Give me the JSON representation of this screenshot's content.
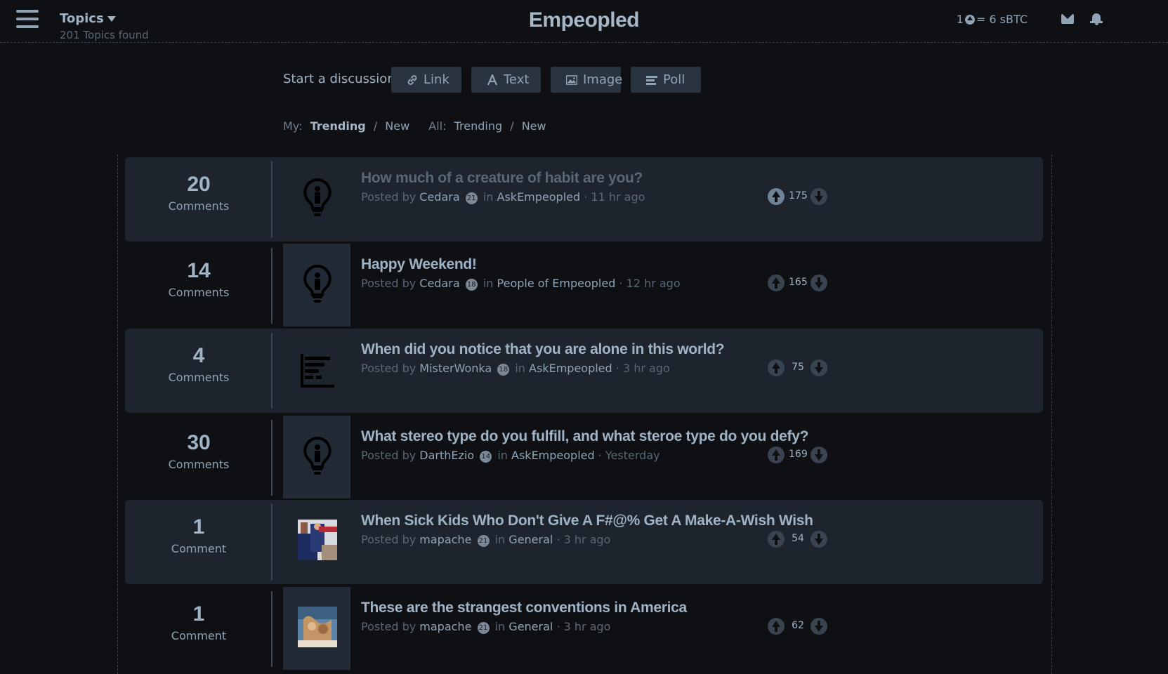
{
  "header": {
    "topics_label": "Topics",
    "topics_found": "201 Topics found",
    "brand": "Empeopled",
    "rate_prefix": "1",
    "rate_suffix": "= 6 sBTC"
  },
  "discussion": {
    "label": "Start a discussion:",
    "buttons": [
      {
        "label": "Link",
        "icon": "link-icon"
      },
      {
        "label": "Text",
        "icon": "text-icon"
      },
      {
        "label": "Image",
        "icon": "image-icon"
      },
      {
        "label": "Poll",
        "icon": "poll-icon"
      }
    ]
  },
  "filters": {
    "my_label": "My:",
    "my_trending": "Trending",
    "sep1": "/",
    "my_new": "New",
    "all_label": "All:",
    "all_trending": "Trending",
    "sep2": "/",
    "all_new": "New"
  },
  "posts": [
    {
      "count": "20",
      "count_label": "Comments",
      "thumb": "lightbulb-icon",
      "title": "How much of a creature of habit are you?",
      "posted_by": "Posted by",
      "author": "Cedara",
      "level": "21",
      "in": "in",
      "community": "AskEmpeopled",
      "time": "· 11 hr ago",
      "score": "175"
    },
    {
      "count": "14",
      "count_label": "Comments",
      "thumb": "lightbulb-icon",
      "title": "Happy Weekend!",
      "posted_by": "Posted by",
      "author": "Cedara",
      "level": "18",
      "in": "in",
      "community": "People of Empeopled",
      "time": "· 12 hr ago",
      "score": "165"
    },
    {
      "count": "4",
      "count_label": "Comments",
      "thumb": "poll-chart-icon",
      "title": "When did you notice that you are alone in this world?",
      "posted_by": "Posted by",
      "author": "MisterWonka",
      "level": "18",
      "in": "in",
      "community": "AskEmpeopled",
      "time": "· 3 hr ago",
      "score": "75"
    },
    {
      "count": "30",
      "count_label": "Comments",
      "thumb": "lightbulb-icon",
      "title": "What stereo type do you fulfill, and what steroe type do you defy?",
      "posted_by": "Posted by",
      "author": "DarthEzio",
      "level": "14",
      "in": "in",
      "community": "AskEmpeopled",
      "time": "· Yesterday",
      "score": "169"
    },
    {
      "count": "1",
      "count_label": "Comment",
      "thumb": "photo-thumbnail",
      "title": "When Sick Kids Who Don't Give A F#@% Get A Make-A-Wish Wish",
      "posted_by": "Posted by",
      "author": "mapache",
      "level": "21",
      "in": "in",
      "community": "General",
      "time": "· 3 hr ago",
      "score": "54"
    },
    {
      "count": "1",
      "count_label": "Comment",
      "thumb": "photo-thumbnail",
      "title": "These are the strangest conventions in America",
      "posted_by": "Posted by",
      "author": "mapache",
      "level": "21",
      "in": "in",
      "community": "General",
      "time": "· 3 hr ago",
      "score": "62"
    }
  ],
  "colors": {
    "background": "#0e1014",
    "row_shade": "#1e242e",
    "text": "#8fa3b4",
    "muted": "#5a6775"
  }
}
